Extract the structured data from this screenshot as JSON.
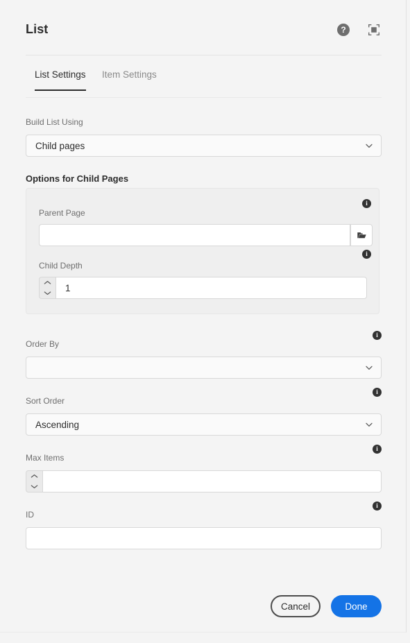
{
  "window": {
    "title": "List",
    "background": "#f4f4f4"
  },
  "header": {
    "title": "List",
    "help_icon": "help-circle-icon",
    "help_glyph": "?",
    "fullscreen_icon": "fullscreen-select-icon"
  },
  "tabs": [
    {
      "label": "List Settings",
      "active": true
    },
    {
      "label": "Item Settings",
      "active": false
    }
  ],
  "form": {
    "build_list_using": {
      "label": "Build List Using",
      "value": "Child pages",
      "placeholder": ""
    },
    "options_section": {
      "heading": "Options for Child Pages",
      "parent_page": {
        "label": "Parent Page",
        "value": "",
        "placeholder": "",
        "browse_icon": "folder-icon",
        "info_icon": "info-icon",
        "info_glyph": "i"
      },
      "child_depth": {
        "label": "Child Depth",
        "value": "1",
        "placeholder": "",
        "increment_icon": "chevron-up-icon",
        "decrement_icon": "chevron-down-icon",
        "info_icon": "info-icon",
        "info_glyph": "i"
      }
    },
    "order_by": {
      "label": "Order By",
      "value": "",
      "placeholder": "",
      "info_glyph": "i"
    },
    "sort_order": {
      "label": "Sort Order",
      "value": "Ascending",
      "placeholder": "",
      "info_glyph": "i"
    },
    "max_items": {
      "label": "Max Items",
      "value": "",
      "placeholder": "",
      "info_glyph": "i"
    },
    "id_field": {
      "label": "ID",
      "value": "",
      "placeholder": "",
      "info_glyph": "i"
    }
  },
  "footer": {
    "cancel_label": "Cancel",
    "done_label": "Done",
    "primary_color": "#1473e6"
  }
}
